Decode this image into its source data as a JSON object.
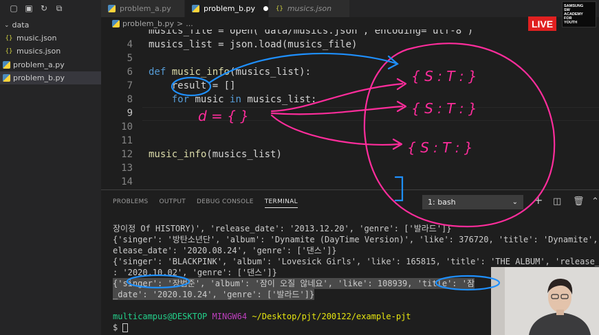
{
  "explorer": {
    "items": [
      {
        "label": "data",
        "icon": "chevron-down-icon"
      },
      {
        "label": "music.json",
        "icon": "json-icon"
      },
      {
        "label": "musics.json",
        "icon": "json-icon"
      },
      {
        "label": "problem_a.py",
        "icon": "python-icon"
      },
      {
        "label": "problem_b.py",
        "icon": "python-icon"
      }
    ]
  },
  "tabs": [
    {
      "label": "problem_a.py"
    },
    {
      "label": "problem_b.py"
    },
    {
      "label": "musics.json"
    }
  ],
  "breadcrumb": {
    "file": "problem_b.py",
    "separator": ">",
    "more": "..."
  },
  "editor": {
    "lines": [
      {
        "num": "",
        "text": "musics_file = open('data/musics.json', encoding='utf-8')"
      },
      {
        "num": "4",
        "text": "musics_list = json.load(musics_file)"
      },
      {
        "num": "5",
        "text": ""
      },
      {
        "num": "6",
        "kw": "def",
        "fn": "music_info",
        "rest": "(musics_list):"
      },
      {
        "num": "7",
        "text": "    result = []"
      },
      {
        "num": "8",
        "kw": "for",
        "mid": "music",
        "kw2": "in",
        "rest": "musics_list:"
      },
      {
        "num": "9",
        "text": ""
      },
      {
        "num": "10",
        "text": ""
      },
      {
        "num": "11",
        "text": ""
      },
      {
        "num": "12",
        "fn": "music_info",
        "rest": "(musics_list)"
      },
      {
        "num": "13",
        "text": ""
      },
      {
        "num": "14",
        "text": ""
      }
    ]
  },
  "live_badge": "LIVE",
  "logo": {
    "lines": [
      "SAMSUNG",
      "SW",
      "ACADEMY",
      "FOR",
      "YOUTH"
    ]
  },
  "panel": {
    "tabs": [
      "PROBLEMS",
      "OUTPUT",
      "DEBUG CONSOLE",
      "TERMINAL"
    ],
    "terminal_select": "1: bash",
    "actions": {
      "add": "+",
      "split": "split-icon",
      "trash": "trash-icon",
      "chevron": "chevron-up-icon",
      "close": "close-icon"
    }
  },
  "terminal": {
    "lines": [
      "장이정 Of HISTORY)', 'release_date': '2013.12.20', 'genre': ['발라드']}",
      "{'singer': '방탄소년단', 'album': 'Dynamite (DayTime Version)', 'like': 376720, 'title': 'Dynamite', 'r",
      "elease_date': '2020.08.24', 'genre': ['댄스']}",
      "{'singer': 'BLACKPINK', 'album': 'Lovesick Girls', 'like': 165815, 'title': 'THE ALBUM', 'release_da",
      ": '2020.10.02', 'genre': ['댄스']}",
      "{'singer': '장범준', 'album': '잠이 오질 않네요', 'like': 108939, 'title': '잠",
      "_date': '2020.10.24', 'genre': ['발라드']}",
      "",
      "",
      "$ "
    ],
    "prompt": {
      "user": "multicampus@DESKTOP",
      "host": "MINGW64",
      "path": "~/Desktop/pjt/200122/example-pjt"
    }
  },
  "annotations": {
    "handwriting": [
      "d = {  }",
      "{ S :    T :    }",
      "{ S :    T :    }",
      "{ S :    T :    }",
      "["
    ]
  },
  "colors": {
    "accent_pen": "#ff2d9c",
    "blue_pen": "#1e90ff",
    "live": "#e02020"
  }
}
